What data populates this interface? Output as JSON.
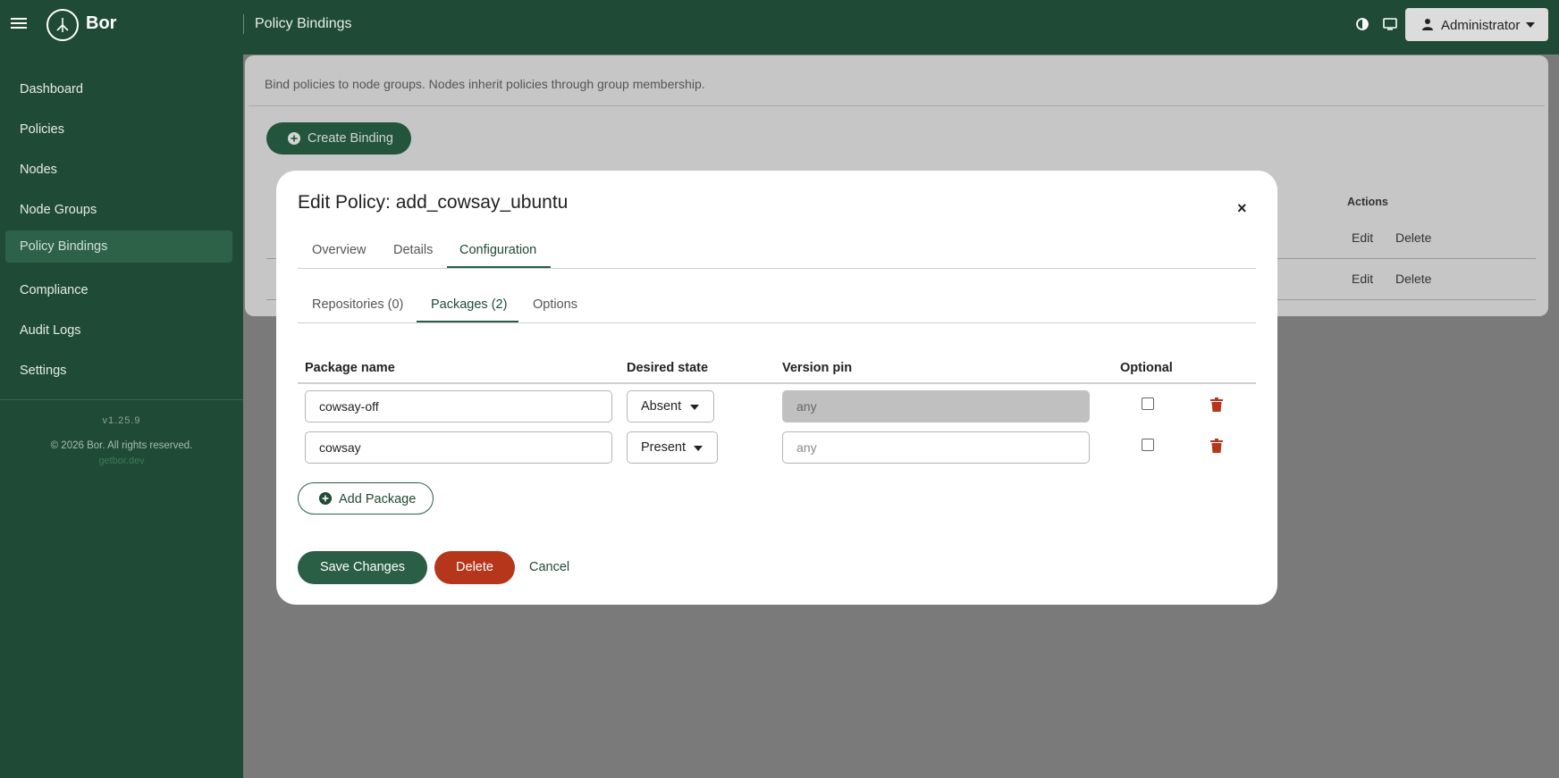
{
  "app": {
    "brand": "Bor",
    "page_title": "Policy Bindings"
  },
  "header": {
    "user_label": "Administrator",
    "icons": [
      "menu-icon",
      "contrast-icon",
      "monitor-icon",
      "user-icon",
      "chevron-down-icon"
    ]
  },
  "sidebar": {
    "items": [
      {
        "label": "Dashboard"
      },
      {
        "label": "Policies"
      },
      {
        "label": "Nodes"
      },
      {
        "label": "Node Groups"
      },
      {
        "label": "Policy Bindings",
        "active": true
      },
      {
        "label": "Compliance"
      },
      {
        "label": "Audit Logs"
      },
      {
        "label": "Settings"
      }
    ],
    "version": "v1.25.9",
    "copyright": "© 2026 Bor. All rights reserved.",
    "site_link": "getbor.dev"
  },
  "main": {
    "description": "Bind policies to node groups. Nodes inherit policies through group membership.",
    "create_button": "Create Binding",
    "table": {
      "actions_header": "Actions",
      "rows": [
        {
          "edit": "Edit",
          "delete": "Delete"
        },
        {
          "edit": "Edit",
          "delete": "Delete"
        }
      ]
    }
  },
  "modal": {
    "title": "Edit Policy: add_cowsay_ubuntu",
    "close_glyph": "×",
    "tabs": [
      {
        "label": "Overview"
      },
      {
        "label": "Details"
      },
      {
        "label": "Configuration",
        "active": true
      }
    ],
    "subtabs": [
      {
        "label": "Repositories (0)"
      },
      {
        "label": "Packages (2)",
        "active": true
      },
      {
        "label": "Options"
      }
    ],
    "columns": {
      "package_name": "Package name",
      "desired_state": "Desired state",
      "version_pin": "Version pin",
      "optional": "Optional"
    },
    "packages": [
      {
        "name": "cowsay-off",
        "state": "Absent",
        "version_pin": "any",
        "version_pin_disabled": true,
        "optional": false
      },
      {
        "name": "cowsay",
        "state": "Present",
        "version_pin_placeholder": "any",
        "version_pin_disabled": false,
        "optional": false
      }
    ],
    "add_package_label": "Add Package",
    "save_label": "Save Changes",
    "delete_label": "Delete",
    "cancel_label": "Cancel"
  },
  "colors": {
    "brand_green": "#1f4a35",
    "accent_green": "#2a5e45",
    "danger": "#b5361a"
  }
}
